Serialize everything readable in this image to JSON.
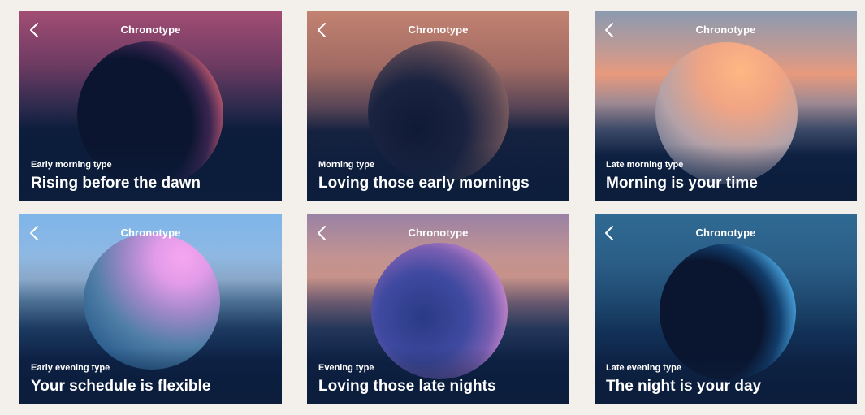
{
  "screen_title": "Chronotype",
  "cards": [
    {
      "subtitle": "Early morning type",
      "headline": "Rising before the dawn"
    },
    {
      "subtitle": "Morning type",
      "headline": "Loving those early mornings"
    },
    {
      "subtitle": "Late morning type",
      "headline": "Morning is your time"
    },
    {
      "subtitle": "Early evening type",
      "headline": "Your schedule is flexible"
    },
    {
      "subtitle": "Evening type",
      "headline": "Loving those late nights"
    },
    {
      "subtitle": "Late evening type",
      "headline": "The night is your day"
    }
  ],
  "icons": {
    "back": "chevron-left-icon"
  },
  "colors": {
    "page_background": "#f3f0ec",
    "text": "#ffffff",
    "night_blue": "#0b1c3b"
  }
}
